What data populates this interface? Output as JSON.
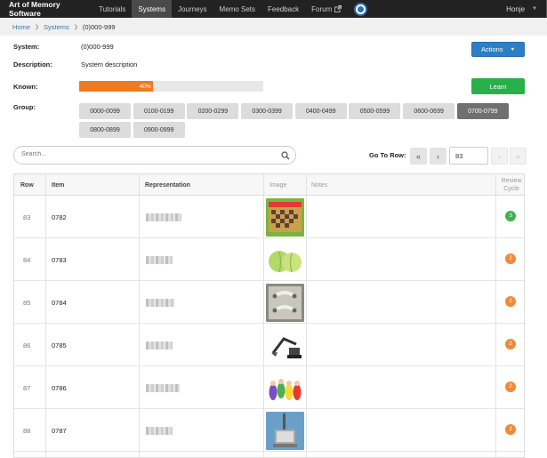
{
  "navbar": {
    "brand": "Art of Memory Software",
    "items": [
      "Tutorials",
      "Systems",
      "Journeys",
      "Memo Sets",
      "Feedback",
      "Forum"
    ],
    "active": "Systems",
    "user": "Honje"
  },
  "breadcrumb": {
    "home": "Home",
    "systems": "Systems",
    "current": "(0)000-999"
  },
  "system": {
    "system_label": "System:",
    "system_value": "(0)000-999",
    "description_label": "Description:",
    "description_value": "System description",
    "known_label": "Known:",
    "known_percent": 40,
    "known_text": "40%",
    "group_label": "Group:"
  },
  "buttons": {
    "actions": "Actions",
    "learn": "Learn"
  },
  "groups": {
    "items": [
      "0000-0099",
      "0100-0199",
      "0200-0299",
      "0300-0399",
      "0400-0499",
      "0500-0599",
      "0600-0699",
      "0700-0799",
      "0800-0899",
      "0900-0999"
    ],
    "selected": "0700-0799"
  },
  "search": {
    "placeholder": "Search..."
  },
  "pager": {
    "label": "Go To Row:",
    "value": "83",
    "first": "«",
    "prev": "‹",
    "next": "›",
    "last": "»"
  },
  "table": {
    "headers": {
      "row": "Row",
      "item": "Item",
      "representation": "Representation",
      "image": "Image",
      "notes": "Notes",
      "review": "Review Cycle"
    },
    "rows": [
      {
        "row": "83",
        "item": "0782",
        "review": "3",
        "review_color": "#3cb54a",
        "image": "chessboard-box"
      },
      {
        "row": "84",
        "item": "0783",
        "review": "2",
        "review_color": "#ee8a3a",
        "image": "cabbage"
      },
      {
        "row": "85",
        "item": "0784",
        "review": "2",
        "review_color": "#ee8a3a",
        "image": "drawer-handle"
      },
      {
        "row": "86",
        "item": "0785",
        "review": "2",
        "review_color": "#ee8a3a",
        "image": "excavator"
      },
      {
        "row": "87",
        "item": "0786",
        "review": "2",
        "review_color": "#ee8a3a",
        "image": "teletubbies"
      },
      {
        "row": "88",
        "item": "0787",
        "review": "2",
        "review_color": "#ee8a3a",
        "image": "machine"
      }
    ]
  },
  "colors": {
    "navbar": "#222222",
    "primary": "#2d7ec4",
    "success": "#28b04a",
    "progress": "#ef7a22"
  }
}
